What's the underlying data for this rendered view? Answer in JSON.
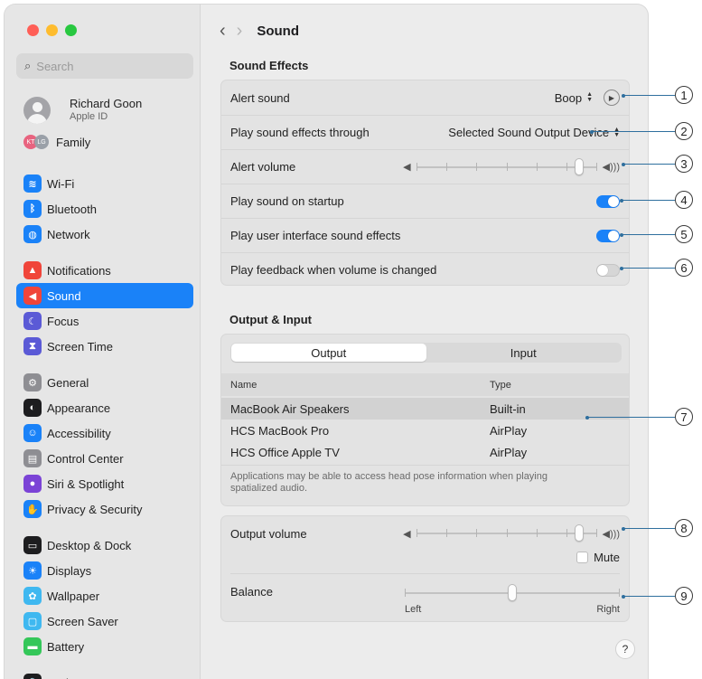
{
  "window": {
    "title": "Sound"
  },
  "sidebar": {
    "search_placeholder": "Search",
    "account": {
      "name": "Richard Goon",
      "subtitle": "Apple ID"
    },
    "family": {
      "label": "Family",
      "badges": [
        "KT",
        "LG"
      ]
    },
    "items": [
      {
        "label": "Wi-Fi",
        "icon": "wifi-icon",
        "color": "#1a82f8"
      },
      {
        "label": "Bluetooth",
        "icon": "bluetooth-icon",
        "color": "#1a82f8"
      },
      {
        "label": "Network",
        "icon": "globe-icon",
        "color": "#1a82f8"
      },
      {
        "label": "Notifications",
        "icon": "bell-icon",
        "color": "#f0453a"
      },
      {
        "label": "Sound",
        "icon": "speaker-icon",
        "color": "#f0453a"
      },
      {
        "label": "Focus",
        "icon": "moon-icon",
        "color": "#5b5ad6"
      },
      {
        "label": "Screen Time",
        "icon": "hourglass-icon",
        "color": "#5b5ad6"
      },
      {
        "label": "General",
        "icon": "gear-icon",
        "color": "#8e8e93"
      },
      {
        "label": "Appearance",
        "icon": "appearance-icon",
        "color": "#1d1d1f"
      },
      {
        "label": "Accessibility",
        "icon": "accessibility-icon",
        "color": "#1a82f8"
      },
      {
        "label": "Control Center",
        "icon": "control-center-icon",
        "color": "#8e8e93"
      },
      {
        "label": "Siri & Spotlight",
        "icon": "siri-icon",
        "color": "#7b43d6"
      },
      {
        "label": "Privacy & Security",
        "icon": "hand-icon",
        "color": "#1a82f8"
      },
      {
        "label": "Desktop & Dock",
        "icon": "dock-icon",
        "color": "#1d1d1f"
      },
      {
        "label": "Displays",
        "icon": "sun-icon",
        "color": "#1a82f8"
      },
      {
        "label": "Wallpaper",
        "icon": "wallpaper-icon",
        "color": "#3fb8f0"
      },
      {
        "label": "Screen Saver",
        "icon": "screen-saver-icon",
        "color": "#3fb8f0"
      },
      {
        "label": "Battery",
        "icon": "battery-icon",
        "color": "#34c759"
      },
      {
        "label": "Lock Screen",
        "icon": "lock-icon",
        "color": "#1d1d1f"
      }
    ]
  },
  "sound_effects": {
    "title": "Sound Effects",
    "alert_sound_label": "Alert sound",
    "alert_sound_value": "Boop",
    "play_through_label": "Play sound effects through",
    "play_through_value": "Selected Sound Output Device",
    "alert_volume_label": "Alert volume",
    "alert_volume_level": 0.92,
    "startup_label": "Play sound on startup",
    "startup_on": true,
    "ui_effects_label": "Play user interface sound effects",
    "ui_effects_on": true,
    "feedback_label": "Play feedback when volume is changed",
    "feedback_on": false
  },
  "output_input": {
    "title": "Output & Input",
    "tabs": [
      "Output",
      "Input"
    ],
    "active_tab": "Output",
    "columns": [
      "Name",
      "Type"
    ],
    "devices": [
      {
        "name": "MacBook Air Speakers",
        "type": "Built-in",
        "selected": true
      },
      {
        "name": "HCS MacBook Pro",
        "type": "AirPlay",
        "selected": false
      },
      {
        "name": "HCS Office Apple TV",
        "type": "AirPlay",
        "selected": false
      }
    ],
    "note_line1": "Applications may be able to access head pose information when playing",
    "note_line2": "spatialized audio."
  },
  "output_volume": {
    "label": "Output volume",
    "level": 0.92,
    "mute_label": "Mute",
    "mute_checked": false,
    "balance_label": "Balance",
    "balance_left": "Left",
    "balance_right": "Right",
    "balance_level": 0.5
  },
  "help_label": "?",
  "callouts": [
    "1",
    "2",
    "3",
    "4",
    "5",
    "6",
    "7",
    "8",
    "9"
  ],
  "colors": {
    "accent": "#1a82f8",
    "callout_line": "#2f6f9e"
  }
}
